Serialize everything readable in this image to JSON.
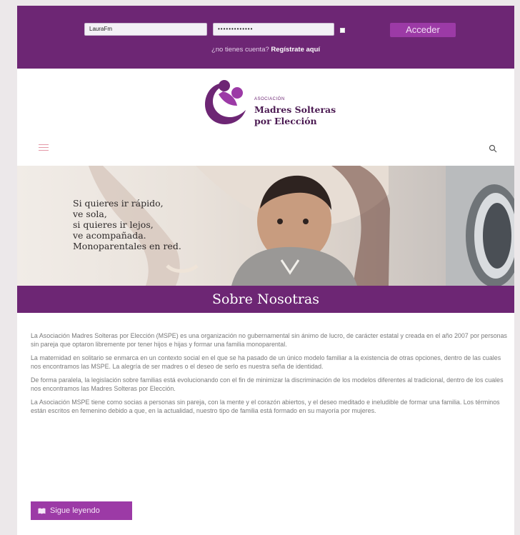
{
  "login": {
    "user_value": "LauraFm",
    "password_value": "•••••••••••••",
    "submit_label": "Acceder",
    "register_prompt": "¿no tienes cuenta?",
    "register_link": "Regístrate aquí"
  },
  "brand": {
    "small": "ASOCIACIÓN",
    "line1": "Madres Solteras",
    "line2": "por Elección",
    "color": "#6d2674",
    "accent": "#9c3aa6"
  },
  "icons": {
    "menu": "menu-icon",
    "search": "search-icon",
    "book": "book-icon"
  },
  "hero": {
    "quote": [
      "Si quieres ir rápido,",
      "ve sola,",
      "si quieres ir lejos,",
      "ve acompañada.",
      "Monoparentales en red."
    ]
  },
  "section": {
    "title": "Sobre Nosotras",
    "paragraphs": [
      "La Asociación Madres Solteras por Elección (MSPE) es una organización no gubernamental sin ánimo de lucro, de carácter estatal y creada en el año 2007 por personas sin pareja que optaron libremente por tener hijos e hijas y formar una familia monoparental.",
      "La maternidad en solitario se enmarca en un contexto social en el que se ha pasado de un único modelo familiar a la existencia de otras opciones, dentro de las cuales nos encontramos las MSPE. La alegría de ser madres o el deseo de serlo es nuestra seña de identidad.",
      "De forma paralela, la legislación sobre familias está evolucionando con el fin de minimizar la discriminación de los modelos diferentes al tradicional, dentro de los cuales nos encontramos las Madres Solteras por Elección.",
      "La Asociación MSPE tiene como socias a personas sin pareja, con la mente y el corazón abiertos, y el deseo meditado e ineludible de formar una familia. Los términos están escritos en femenino debido a que, en la actualidad, nuestro tipo de familia está formado en su mayoría por mujeres."
    ],
    "cta_label": "Sigue leyendo"
  }
}
